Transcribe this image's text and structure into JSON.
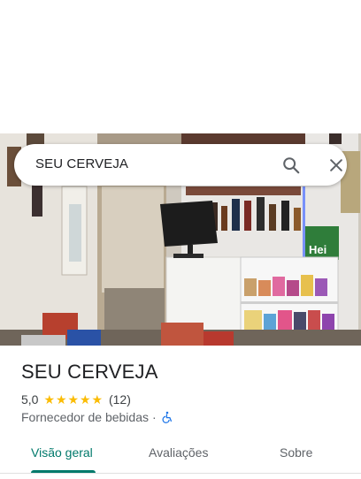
{
  "search": {
    "query": "SEU CERVEJA"
  },
  "place": {
    "name": "SEU CERVEJA",
    "rating": "5,0",
    "stars": 5,
    "review_count": "(12)",
    "category": "Fornecedor de bebidas",
    "separator": "·",
    "beer_sign": "Hei"
  },
  "tabs": [
    {
      "label": "Visão geral",
      "active": true
    },
    {
      "label": "Avaliações",
      "active": false
    },
    {
      "label": "Sobre",
      "active": false
    }
  ],
  "colors": {
    "accent": "#00796b",
    "star": "#fbbc04",
    "accessibility": "#1a73e8"
  },
  "icons": {
    "search": "search-icon",
    "close": "close-icon",
    "accessibility": "wheelchair-icon"
  }
}
